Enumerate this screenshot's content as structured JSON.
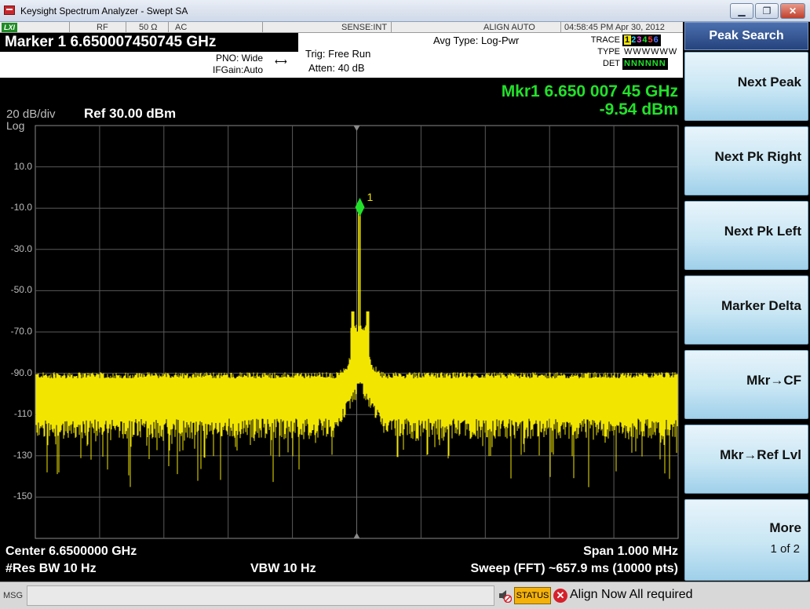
{
  "window": {
    "title": "Keysight Spectrum Analyzer - Swept SA",
    "minimize_glyph": "▁",
    "maximize_glyph": "❐",
    "close_glyph": "✕"
  },
  "status_strip": {
    "logo": "LXI",
    "input": "RF",
    "impedance": "50 Ω",
    "coupling": "AC",
    "sense": "SENSE:INT",
    "align": "ALIGN AUTO",
    "datetime": "04:58:45 PM Apr 30, 2012"
  },
  "header": {
    "marker_readout": "Marker 1 6.650007450745 GHz",
    "pno": "PNO: Wide",
    "ifgain": "IFGain:Auto",
    "trig": "Trig: Free Run",
    "atten": "Atten: 40 dB",
    "avg_type": "Avg Type: Log-Pwr",
    "trace_label": "TRACE",
    "type_label": "TYPE",
    "det_label": "DET",
    "trace_numbers": [
      "1",
      "2",
      "3",
      "4",
      "5",
      "6"
    ],
    "trace_colors": [
      "#f2e600",
      "#2ad4ff",
      "#ff4df5",
      "#22e12a",
      "#ff3b3b",
      "#5577ff"
    ],
    "trace_types": "WWWWWW",
    "trace_dets": "NNNNNN"
  },
  "display": {
    "mkr_freq": "Mkr1 6.650 007 45 GHz",
    "mkr_amp": "-9.54 dBm",
    "scale": "20 dB/div",
    "log": "Log",
    "ref": "Ref 30.00 dBm",
    "y_ticks": [
      "10.0",
      "-10.0",
      "-30.0",
      "-50.0",
      "-70.0",
      "-90.0",
      "-110",
      "-130",
      "-150"
    ],
    "marker_number": "1",
    "center": "Center 6.6500000 GHz",
    "span": "Span 1.000 MHz",
    "res_bw": "#Res BW 10 Hz",
    "vbw": "VBW 10 Hz",
    "sweep": "Sweep (FFT)  ~657.9 ms (10000 pts)",
    "trace_color": "#f2e600",
    "marker_color": "#22e12a"
  },
  "softkeys": {
    "menu_title": "Peak Search",
    "keys": [
      {
        "label": "Next Peak",
        "sub": ""
      },
      {
        "label": "Next Pk Right",
        "sub": ""
      },
      {
        "label": "Next Pk Left",
        "sub": ""
      },
      {
        "label": "Marker Delta",
        "sub": ""
      },
      {
        "label": "Mkr→CF",
        "sub": ""
      },
      {
        "label": "Mkr→Ref Lvl",
        "sub": ""
      },
      {
        "label": "More",
        "sub": "1 of 2"
      }
    ]
  },
  "msgbar": {
    "label": "MSG",
    "status": "STATUS",
    "error_glyph": "✕",
    "message": "Align Now All required"
  }
}
